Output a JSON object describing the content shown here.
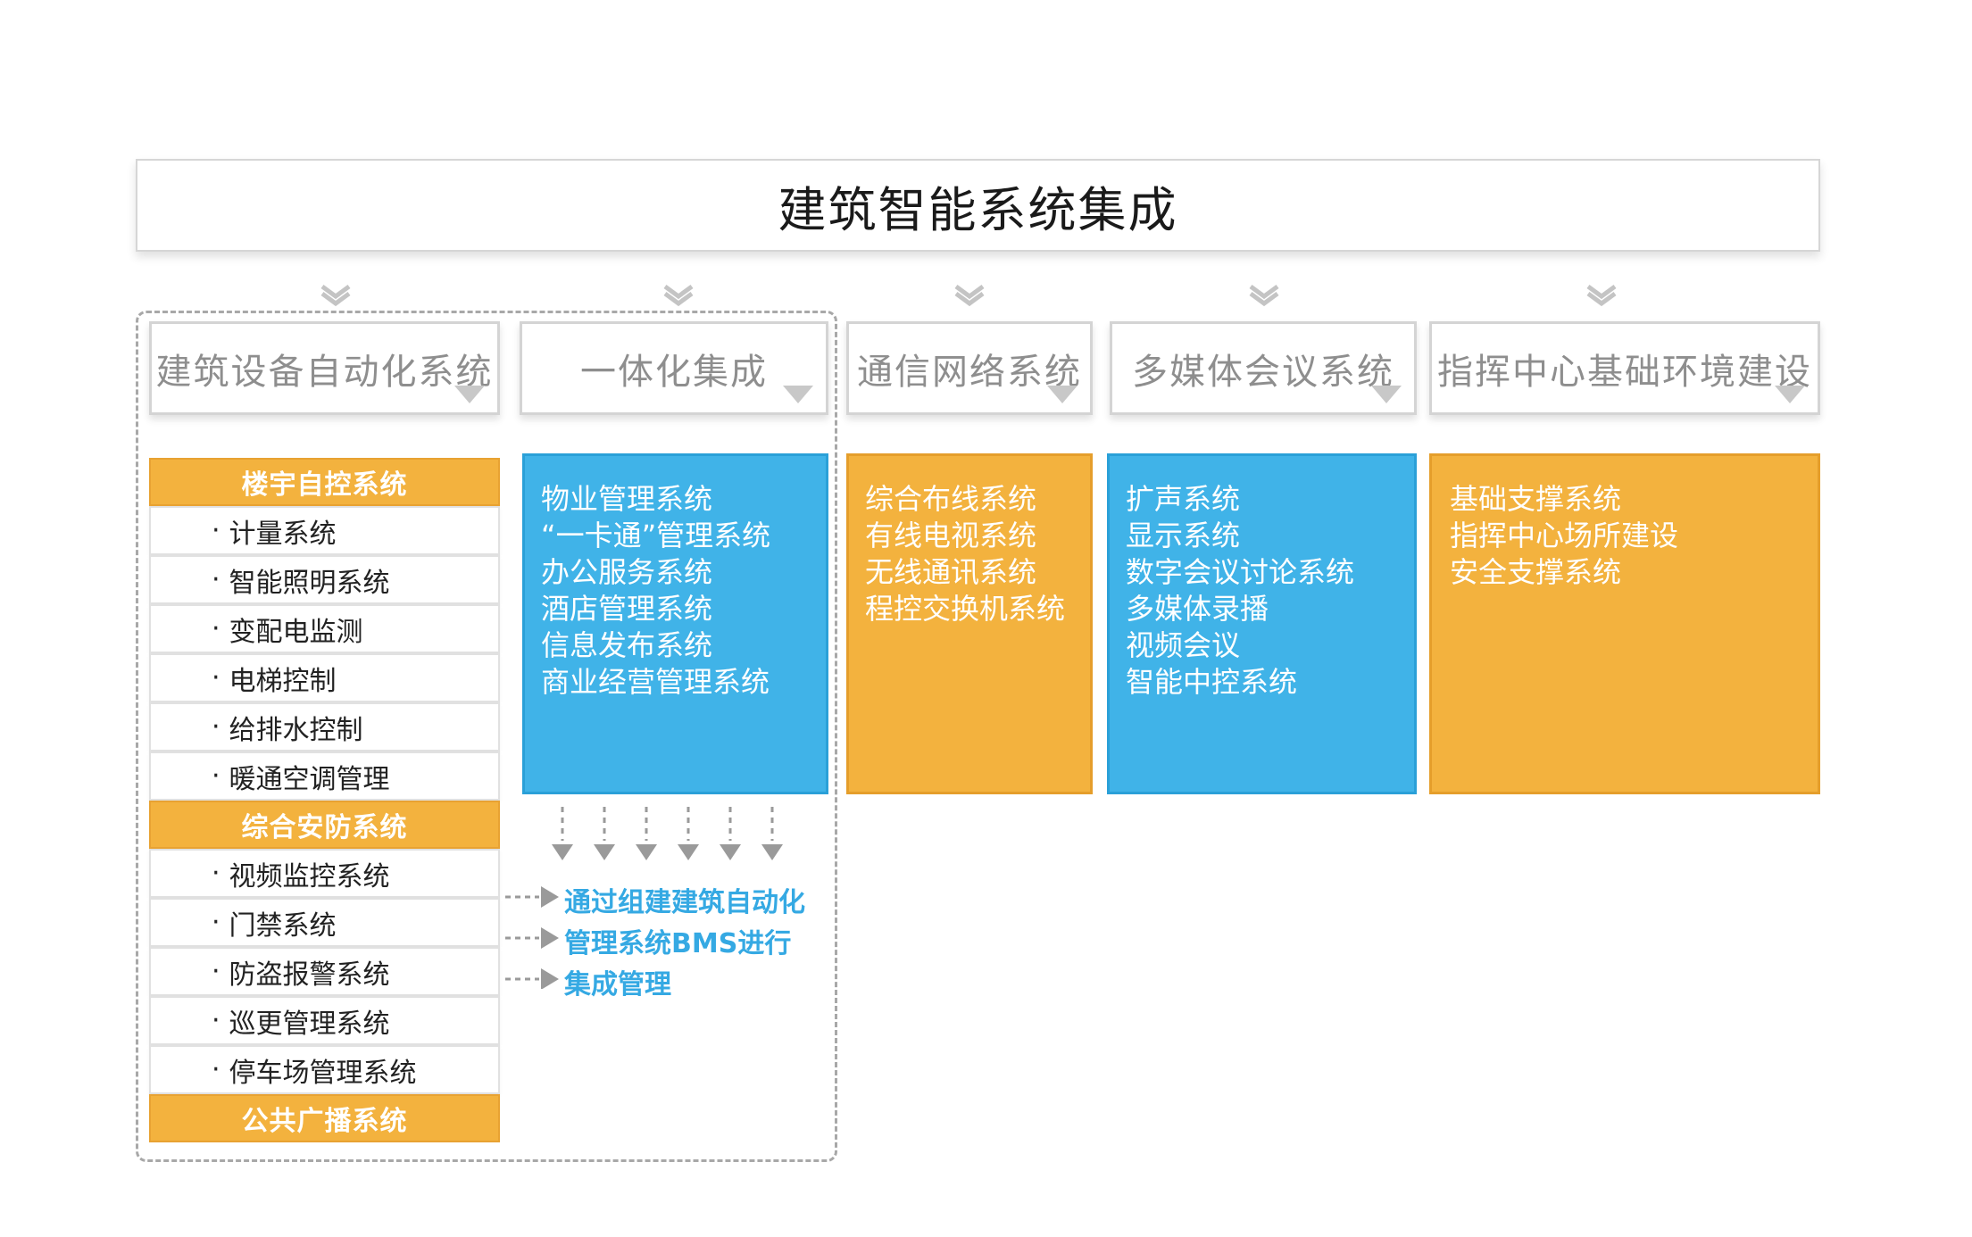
{
  "title": "建筑智能系统集成",
  "categories": [
    {
      "label": "建筑设备自动化系统"
    },
    {
      "label": "一体化集成"
    },
    {
      "label": "通信网络系统"
    },
    {
      "label": "多媒体会议系统"
    },
    {
      "label": "指挥中心基础环境建设"
    }
  ],
  "building_automation": {
    "groups": [
      {
        "header": "楼宇自控系统",
        "items": [
          "计量系统",
          "智能照明系统",
          "变配电监测",
          "电梯控制",
          "给排水控制",
          "暖通空调管理"
        ]
      },
      {
        "header": "综合安防系统",
        "items": [
          "视频监控系统",
          "门禁系统",
          "防盗报警系统",
          "巡更管理系统",
          "停车场管理系统"
        ]
      },
      {
        "header": "公共广播系统",
        "items": []
      }
    ],
    "bullet": "·"
  },
  "panels": {
    "integration": [
      "物业管理系统",
      "“一卡通”管理系统",
      "办公服务系统",
      "酒店管理系统",
      "信息发布系统",
      "商业经营管理系统"
    ],
    "network": [
      "综合布线系统",
      "有线电视系统",
      "无线通讯系统",
      "程控交换机系统"
    ],
    "multimedia": [
      "扩声系统",
      "显示系统",
      "数字会议讨论系统",
      "多媒体录播",
      "视频会议",
      "智能中控系统"
    ],
    "command": [
      "基础支撑系统",
      "指挥中心场所建设",
      "安全支撑系统"
    ]
  },
  "bms_note": [
    "通过组建建筑自动化",
    "管理系统BMS进行",
    "集成管理"
  ],
  "colors": {
    "orange": "#f3b23e",
    "blue": "#40b3e8",
    "note_blue": "#35a9e3",
    "border_gray": "#d4d4d4"
  }
}
